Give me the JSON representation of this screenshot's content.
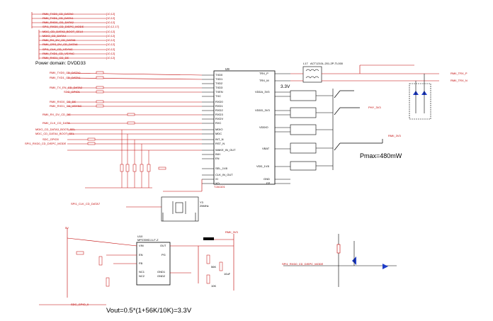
{
  "power_domain": "Power domain: DVDD33",
  "supply_label": "3.3V",
  "pmax": "Pmax=480mW",
  "vout_formula": "Vout=0.5*(1+56K/10K)=3.3V",
  "ic_main": {
    "ref": "U9",
    "part": "TJA1101",
    "pins_left": [
      "TXD0",
      "TXD1",
      "TXD2",
      "TXD3",
      "TXEN",
      "TXC",
      "RXD0",
      "RXD1",
      "RXD2",
      "RXD3",
      "RXDV",
      "RXC",
      "MDIO",
      "MDC",
      "INT_N",
      "RST_N",
      "WAKE_IN_OUT",
      "INH",
      "EN",
      "SEL_1V8",
      "CLK_IN_OUT",
      "XI",
      "XO"
    ],
    "pins_right": [
      "TRX_P",
      "TRX_M",
      "VDDA_3V3",
      "VDDD_3V3",
      "VDDIO",
      "VBAT",
      "VDD_1V8",
      "GND",
      "EP"
    ]
  },
  "ic_ldo": {
    "ref": "U10",
    "part": "MP2359DJ-LF-Z",
    "pins_left": [
      "VIN",
      "EN",
      "FB",
      "NC1",
      "NC2"
    ],
    "pins_right": [
      "OUT",
      "PG",
      "GND1",
      "GND2"
    ]
  },
  "inductor": {
    "ref": "L17",
    "part": "ACT1210L-201-2P-TL000"
  },
  "crystal": {
    "ref": "Y3",
    "part": "25MHz"
  },
  "nets_top": [
    "RMII_TXD0_CD_DATA0",
    "RMII_TXD1_CD_DATA1",
    "RMII_RXD0_CD_DATA2",
    "SPI1_RXD0_CD_DISPC_MODE",
    "MDC_CD_DATA3_BOOT_SEL0",
    "MDIO_CD_DATA4",
    "RMII_RX_DV_CD_DATA5",
    "RMII_CRS_DV_CD_DATA6",
    "SPI1_CLK_CD_VSYNC",
    "RMII_TXD1_CD_VSYNC",
    "RMII_RXD1_CD_DE"
  ],
  "nets_left": [
    "RMII_TXD0_CD_DATA0",
    "RMII_TXD1_CD_DATA1",
    "RMII_TX_EN_CD_DATA2",
    "SDC_GPIO1",
    "RMII_RXD0_CD_DE",
    "RMII_RXD1_CD_VSYNC",
    "RMII_RX_DV_CD_DE",
    "RMII_CLK_CD_DATA",
    "MDIO_CD_DATA3_BOOT_SEL",
    "MDC_CD_DATA4_BOOT_SEL",
    "SDC_GPIO0",
    "SPI1_RXD0_CD_DISPC_MODE",
    "SPI1_CLK_CD_DATA7"
  ],
  "nets_right": [
    "RMII_TRX_P",
    "RMII_TRX_N",
    "PHY_3V3",
    "RMII_3V3"
  ],
  "sheet_refs": [
    "[10,12]",
    "[10,12]",
    "[10,12]",
    "[10,12,17]",
    "[10,12]",
    "[10,12]",
    "[10,12]",
    "[10,12]",
    "[10,12]",
    "[10,12]",
    "[10,12]"
  ],
  "bottom_labels": {
    "sdc_gpio": "SDC_GPIO_0",
    "spi1_net": "SPI1_RXD0_CD_DISPC_MODE",
    "out_net": "RMII_3V3",
    "pwr": "5V",
    "r_top": "56K",
    "r_bot": "10K",
    "cap": "10uF"
  }
}
